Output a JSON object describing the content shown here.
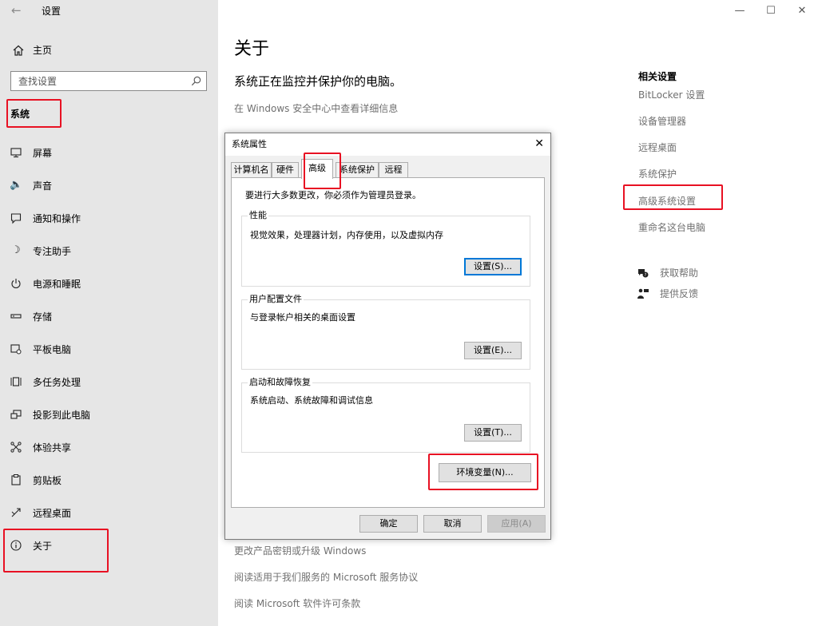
{
  "window": {
    "back_icon": "back-arrow-icon",
    "title": "设置",
    "controls": {
      "minimize": "—",
      "maximize": "☐",
      "close": "✕"
    }
  },
  "sidebar": {
    "home": {
      "label": "主页",
      "icon": "home-icon"
    },
    "search_placeholder": "查找设置",
    "section_label": "系统",
    "items": [
      {
        "label": "屏幕",
        "icon": "display-icon"
      },
      {
        "label": "声音",
        "icon": "sound-icon"
      },
      {
        "label": "通知和操作",
        "icon": "notification-icon"
      },
      {
        "label": "专注助手",
        "icon": "focus-assist-icon"
      },
      {
        "label": "电源和睡眠",
        "icon": "power-icon"
      },
      {
        "label": "存储",
        "icon": "storage-icon"
      },
      {
        "label": "平板电脑",
        "icon": "tablet-icon"
      },
      {
        "label": "多任务处理",
        "icon": "multitasking-icon"
      },
      {
        "label": "投影到此电脑",
        "icon": "projection-icon"
      },
      {
        "label": "体验共享",
        "icon": "shared-experiences-icon"
      },
      {
        "label": "剪贴板",
        "icon": "clipboard-icon"
      },
      {
        "label": "远程桌面",
        "icon": "remote-desktop-icon"
      },
      {
        "label": "关于",
        "icon": "info-icon"
      }
    ]
  },
  "main": {
    "title": "关于",
    "protection_text": "系统正在监控并保护你的电脑。",
    "security_link": "在 Windows 安全中心中查看详细信息",
    "bottom_links": [
      "更改产品密钥或升级 Windows",
      "阅读适用于我们服务的 Microsoft 服务协议",
      "阅读 Microsoft 软件许可条款"
    ]
  },
  "related": {
    "heading": "相关设置",
    "links": [
      "BitLocker 设置",
      "设备管理器",
      "远程桌面",
      "系统保护",
      "高级系统设置",
      "重命名这台电脑"
    ],
    "help": [
      {
        "label": "获取帮助",
        "icon": "help-icon"
      },
      {
        "label": "提供反馈",
        "icon": "feedback-icon"
      }
    ]
  },
  "dialog": {
    "title": "系统属性",
    "close": "✕",
    "tabs": [
      "计算机名",
      "硬件",
      "高级",
      "系统保护",
      "远程"
    ],
    "active_tab": "高级",
    "admin_note": "要进行大多数更改，你必须作为管理员登录。",
    "groups": [
      {
        "title": "性能",
        "desc": "视觉效果，处理器计划，内存使用，以及虚拟内存",
        "button": "设置(S)..."
      },
      {
        "title": "用户配置文件",
        "desc": "与登录帐户相关的桌面设置",
        "button": "设置(E)..."
      },
      {
        "title": "启动和故障恢复",
        "desc": "系统启动、系统故障和调试信息",
        "button": "设置(T)..."
      }
    ],
    "env_button": "环境变量(N)...",
    "ok": "确定",
    "cancel": "取消",
    "apply": "应用(A)"
  },
  "colors": {
    "highlight_border": "#e81123",
    "link_gray": "#707070",
    "sidebar_bg": "#e6e6e6"
  }
}
